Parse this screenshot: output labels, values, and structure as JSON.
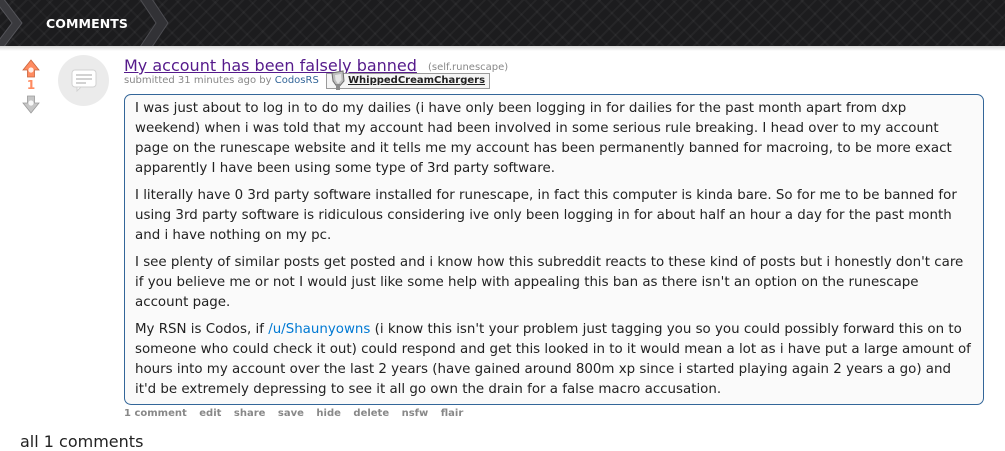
{
  "header": {
    "tab_label": "COMMENTS",
    "bg_color": "#1c1c1e"
  },
  "post": {
    "score": "1",
    "title": "My account has been falsely banned",
    "domain": "(self.runescape)",
    "tagline": {
      "submitted_prefix": "submitted 31 minutes ago by",
      "author": "CodosRS",
      "flair": "WhippedCreamChargers"
    },
    "thumbnail_icon": "self-text-icon",
    "body": {
      "p1": "I was just about to log in to do my dailies (i have only been logging in for dailies for the past month apart from dxp weekend) when i was told that my account had been involved in some serious rule breaking. I head over to my account page on the runescape website and it tells me my account has been permanently banned for macroing, to be more exact apparently I have been using some type of 3rd party software.",
      "p2": "I literally have 0 3rd party software installed for runescape, in fact this computer is kinda bare. So for me to be banned for using 3rd party software is ridiculous considering ive only been logging in for about half an hour a day for the past month and i have nothing on my pc.",
      "p3": "I see plenty of similar posts get posted and i know how this subreddit reacts to these kind of posts but i honestly don't care if you believe me or not I would just like some help with appealing this ban as there isn't an option on the runescape account page.",
      "p4_before": "My RSN is Codos, if ",
      "p4_link": "/u/Shaunyowns",
      "p4_after": " (i know this isn't your problem just tagging you so you could possibly forward this on to someone who could check it out) could respond and get this looked in to it would mean a lot as i have put a large amount of hours into my account over the last 2 years (have gained around 800m xp since i started playing again 2 years a go) and it'd be extremely depressing to see it all go own the drain for a false macro accusation."
    },
    "buttons": {
      "comments": "1 comment",
      "edit": "edit",
      "share": "share",
      "save": "save",
      "hide": "hide",
      "delete": "delete",
      "nsfw": "nsfw",
      "flair": "flair"
    }
  },
  "footer": {
    "all_comments": "all 1 comments"
  },
  "colors": {
    "upvoted": "#ff8b60",
    "link": "#0079d3",
    "visited_title": "#551a8b",
    "box_border": "#336699"
  }
}
